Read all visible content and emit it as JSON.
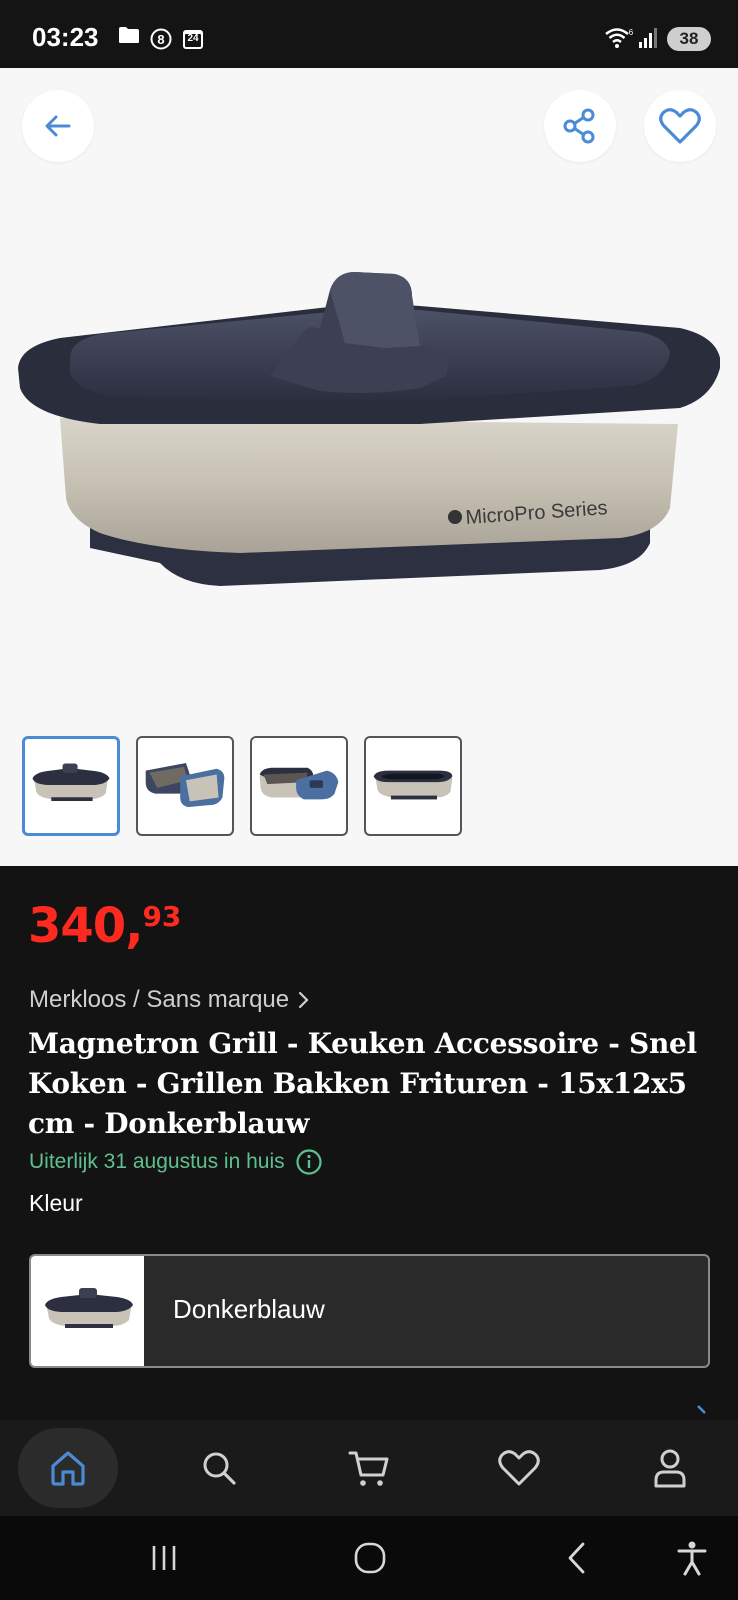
{
  "status_bar": {
    "time": "03:23",
    "calendar_badge": "24",
    "battery": "38",
    "icons": [
      "folder-icon",
      "circle-8-icon",
      "calendar-icon",
      "wifi-icon",
      "signal-icon",
      "battery-icon"
    ]
  },
  "header": {
    "back_icon": "arrow-left-icon",
    "share_icon": "share-icon",
    "favorite_icon": "heart-icon"
  },
  "product_image": {
    "brand_text": "MicroPro Series"
  },
  "thumbnails": {
    "count": 4,
    "selected_index": 0
  },
  "product": {
    "price_main": "340,",
    "price_cents": "93",
    "brand": "Merkloos / Sans marque",
    "title": "Magnetron Grill - Keuken Accessoire - Snel Koken - Grillen Bakken Frituren - 15x12x5 cm - Donkerblauw",
    "delivery": "Uiterlijk 31 augustus in huis",
    "color_label": "Kleur",
    "color_value": "Donkerblauw"
  },
  "bottom_nav": {
    "items": [
      "home-icon",
      "search-icon",
      "cart-icon",
      "heart-icon",
      "account-icon"
    ],
    "active": "home-icon"
  },
  "system_nav": {
    "items": [
      "recents-icon",
      "home-circle-icon",
      "back-chevron-icon",
      "accessibility-icon"
    ]
  },
  "colors": {
    "price_red": "#ff2a1f",
    "delivery_green": "#5fc08f",
    "accent_blue": "#4b8bd6",
    "background_dark": "#131313"
  }
}
